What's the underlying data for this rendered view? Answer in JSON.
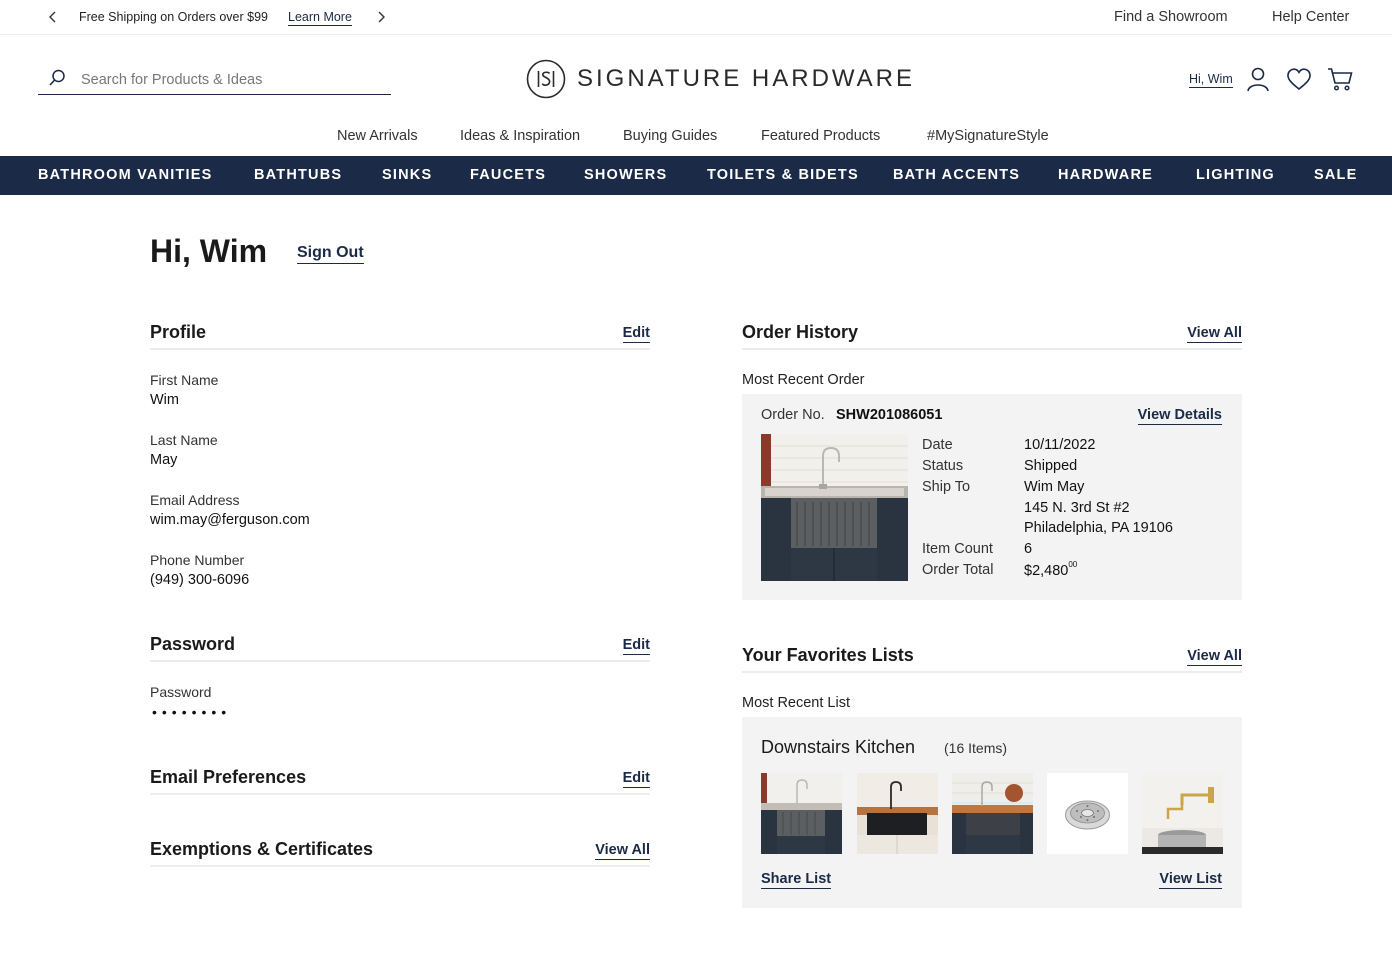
{
  "promo": {
    "text": "Free Shipping on Orders over $99",
    "link": "Learn More"
  },
  "utility": {
    "showroom": "Find a Showroom",
    "help": "Help Center"
  },
  "header": {
    "search_placeholder": "Search for Products & Ideas",
    "brand": "SIGNATURE HARDWARE",
    "greeting": "Hi, Wim"
  },
  "subnav": [
    "New Arrivals",
    "Ideas & Inspiration",
    "Buying Guides",
    "Featured Products",
    "#MySignatureStyle"
  ],
  "mainnav": [
    "BATHROOM VANITIES",
    "BATHTUBS",
    "SINKS",
    "FAUCETS",
    "SHOWERS",
    "TOILETS & BIDETS",
    "BATH ACCENTS",
    "HARDWARE",
    "LIGHTING",
    "SALE"
  ],
  "account": {
    "title": "Hi, Wim",
    "sign_out": "Sign Out"
  },
  "profile": {
    "title": "Profile",
    "edit": "Edit",
    "fields": [
      {
        "label": "First Name",
        "value": "Wim"
      },
      {
        "label": "Last Name",
        "value": "May"
      },
      {
        "label": "Email Address",
        "value": "wim.may@ferguson.com"
      },
      {
        "label": "Phone Number",
        "value": "(949) 300-6096"
      }
    ]
  },
  "password": {
    "title": "Password",
    "edit": "Edit",
    "label": "Password",
    "masked": "••••••••"
  },
  "email_prefs": {
    "title": "Email Preferences",
    "edit": "Edit"
  },
  "exemptions": {
    "title": "Exemptions & Certificates",
    "view_all": "View All"
  },
  "order_history": {
    "title": "Order History",
    "view_all": "View All",
    "subtitle": "Most Recent Order",
    "order_no_label": "Order No.",
    "order_no": "SHW201086051",
    "view_details": "View Details",
    "date_label": "Date",
    "date": "10/11/2022",
    "status_label": "Status",
    "status": "Shipped",
    "ship_to_label": "Ship To",
    "ship_to_name": "Wim May",
    "ship_to_street": "145 N. 3rd St #2",
    "ship_to_city": "Philadelphia, PA 19106",
    "item_count_label": "Item Count",
    "item_count": "6",
    "total_label": "Order Total",
    "total_main": "$2,480",
    "total_cents": "00"
  },
  "favorites": {
    "title": "Your Favorites Lists",
    "view_all": "View All",
    "subtitle": "Most Recent List",
    "list_name": "Downstairs Kitchen",
    "list_count": "(16 Items)",
    "share": "Share List",
    "view": "View List"
  },
  "colors": {
    "navy": "#1b2a47",
    "card_bg": "#f3f3f4"
  }
}
